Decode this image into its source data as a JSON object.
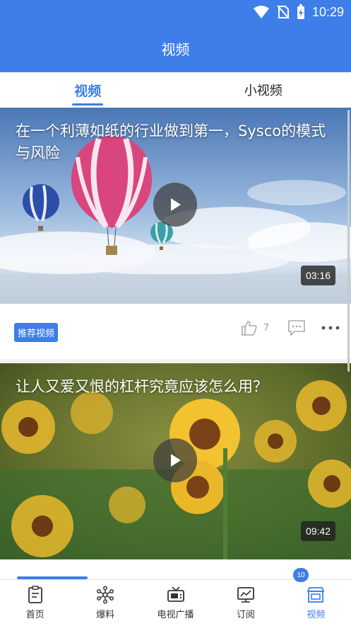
{
  "status_bar": {
    "time": "10:29"
  },
  "app_bar": {
    "title": "视频"
  },
  "tabs": [
    {
      "label": "视频",
      "active": true
    },
    {
      "label": "小视频",
      "active": false
    }
  ],
  "feed": {
    "cards": [
      {
        "title": "在一个利薄如纸的行业做到第一，Sysco的模式与风险",
        "duration": "03:16",
        "tag": "推荐视频",
        "likes": "7"
      },
      {
        "title": "让人又爱又恨的杠杆究竟应该怎么用？",
        "duration": "09:42"
      }
    ]
  },
  "bottom_nav": {
    "items": [
      {
        "label": "首页",
        "icon": "home-doc-icon"
      },
      {
        "label": "爆料",
        "icon": "molecule-icon"
      },
      {
        "label": "电视广播",
        "icon": "tv-icon"
      },
      {
        "label": "订阅",
        "icon": "subscribe-chart-icon"
      },
      {
        "label": "视频",
        "icon": "video-store-icon"
      }
    ],
    "badge": "10"
  },
  "colors": {
    "primary": "#3d7ee8"
  }
}
